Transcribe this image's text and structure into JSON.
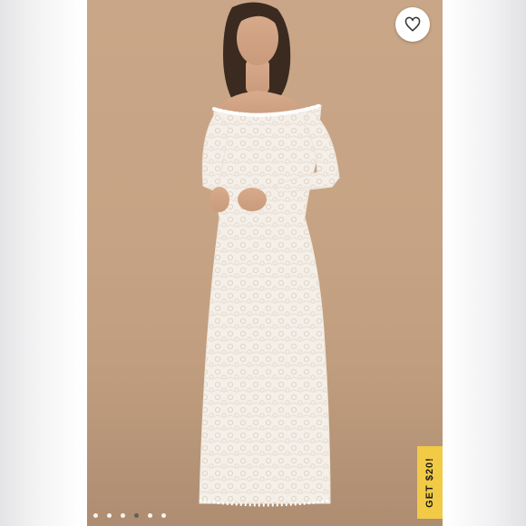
{
  "gallery": {
    "image_alt": "",
    "slide_count": 6,
    "active_slide_index": 3,
    "backdrop_color": "#c6a384"
  },
  "favorite": {
    "icon": "heart-outline-icon"
  },
  "promo": {
    "label": "GET $20!",
    "color": "#f2cb46"
  }
}
